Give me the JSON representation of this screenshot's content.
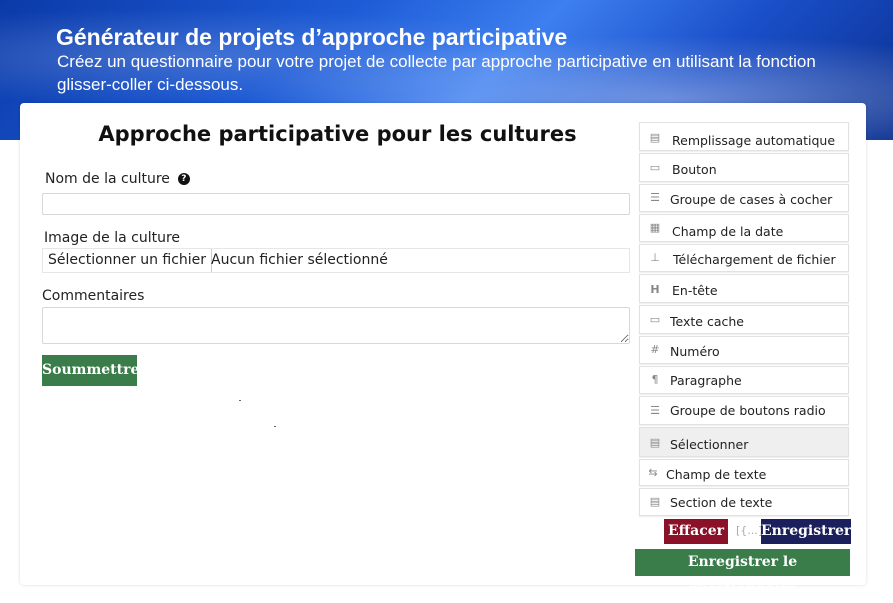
{
  "header": {
    "title": "Générateur de projets d’approche participative",
    "subtitle": "Créez un questionnaire pour votre projet de collecte par approche participative en utilisant la fonction glisser-coller ci-dessous."
  },
  "form": {
    "title": "Approche participative pour les cultures",
    "crop_name_label": "Nom de la culture",
    "help_icon": "?",
    "crop_image_label": "Image de la culture",
    "file_button": "Sélectionner un fichier",
    "file_status": "Aucun fichier sélectionné",
    "comments_label": "Commentaires",
    "submit_label": "Soummettre"
  },
  "palette": {
    "items": [
      {
        "label": "Remplissage automatique",
        "icon": "autofill-icon"
      },
      {
        "label": "Bouton",
        "icon": "button-icon"
      },
      {
        "label": "Groupe de cases à cocher",
        "icon": "checkbox-group-icon"
      },
      {
        "label": "Champ de la date",
        "icon": "calendar-icon"
      },
      {
        "label": "Téléchargement de fichier",
        "icon": "upload-icon"
      },
      {
        "label": "En-tête",
        "icon": "header-icon"
      },
      {
        "label": "Texte cache",
        "icon": "hidden-text-icon"
      },
      {
        "label": "Numéro",
        "icon": "number-icon"
      },
      {
        "label": "Paragraphe",
        "icon": "paragraph-icon"
      },
      {
        "label": "Groupe de boutons radio",
        "icon": "radio-group-icon"
      },
      {
        "label": "Sélectionner",
        "icon": "select-icon"
      },
      {
        "label": "Champ de texte",
        "icon": "text-field-icon"
      },
      {
        "label": "Section de texte",
        "icon": "textarea-icon"
      }
    ]
  },
  "actions": {
    "clear_label": "Effacer",
    "json_label": "[{...}]",
    "save_label": "Enregistrer",
    "save_form_label": "Enregistrer le questionnaire"
  },
  "colors": {
    "banner_blue": "#1d5bd6",
    "submit_green": "#3b7d4a",
    "clear_red": "#8a1128",
    "save_navy": "#1b1f5c"
  }
}
